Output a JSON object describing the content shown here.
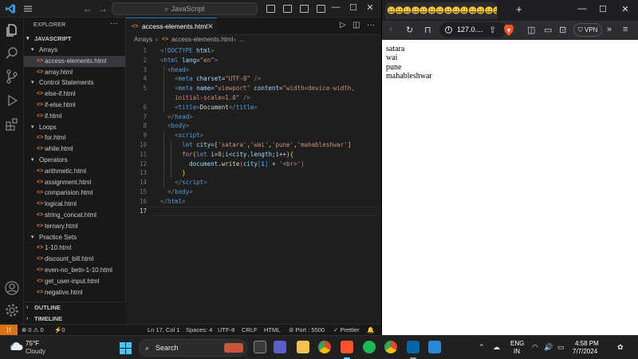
{
  "vscode": {
    "search_placeholder": "JavaScript",
    "explorer_title": "EXPLORER",
    "explorer_more": "···",
    "workspace": "JAVASCRIPT",
    "tree": [
      {
        "type": "folder",
        "label": "Arrays",
        "depth": 1
      },
      {
        "type": "file",
        "label": "access-elements.html",
        "depth": 2,
        "selected": true
      },
      {
        "type": "file",
        "label": "array.html",
        "depth": 2
      },
      {
        "type": "folder",
        "label": "Control Statements",
        "depth": 1
      },
      {
        "type": "file",
        "label": "else-if.html",
        "depth": 2
      },
      {
        "type": "file",
        "label": "if-else.html",
        "depth": 2
      },
      {
        "type": "file",
        "label": "if.html",
        "depth": 2
      },
      {
        "type": "folder",
        "label": "Loops",
        "depth": 1
      },
      {
        "type": "file",
        "label": "for.html",
        "depth": 2
      },
      {
        "type": "file",
        "label": "while.html",
        "depth": 2
      },
      {
        "type": "folder",
        "label": "Operators",
        "depth": 1
      },
      {
        "type": "file",
        "label": "arithmetic.html",
        "depth": 2
      },
      {
        "type": "file",
        "label": "assignment.html",
        "depth": 2
      },
      {
        "type": "file",
        "label": "comparision.html",
        "depth": 2
      },
      {
        "type": "file",
        "label": "logical.html",
        "depth": 2
      },
      {
        "type": "file",
        "label": "string_concat.html",
        "depth": 2
      },
      {
        "type": "file",
        "label": "ternary.html",
        "depth": 2
      },
      {
        "type": "folder",
        "label": "Practice Sets",
        "depth": 1
      },
      {
        "type": "file",
        "label": "1-10.html",
        "depth": 2
      },
      {
        "type": "file",
        "label": "discount_bill.html",
        "depth": 2
      },
      {
        "type": "file",
        "label": "even-no_betn-1-10.html",
        "depth": 2
      },
      {
        "type": "file",
        "label": "get_user-input.html",
        "depth": 2
      },
      {
        "type": "file",
        "label": "negative.html",
        "depth": 2
      }
    ],
    "outline_label": "OUTLINE",
    "timeline_label": "TIMELINE",
    "tab": {
      "title": "access-elements.html",
      "icon": "<>"
    },
    "breadcrumb": {
      "folder": "Arrays",
      "sep1": "›",
      "file_icon": "<>",
      "file": "access-elements.html",
      "sep2": "›",
      "more": "..."
    },
    "line_numbers": [
      "1",
      "2",
      "3",
      "4",
      "5",
      "",
      "6",
      "7",
      "8",
      "9",
      "10",
      "11",
      "12",
      "13",
      "14",
      "15",
      "16",
      "17"
    ],
    "code_lines": [
      [
        {
          "c": "t-br",
          "t": "<!"
        },
        {
          "c": "t-tag",
          "t": "DOCTYPE"
        },
        {
          "c": "t-attr",
          "t": " html"
        },
        {
          "c": "t-br",
          "t": ">"
        }
      ],
      [
        {
          "c": "t-br",
          "t": "<"
        },
        {
          "c": "t-tag",
          "t": "html"
        },
        {
          "c": "t-attr",
          "t": " lang"
        },
        {
          "c": "t-txt",
          "t": "="
        },
        {
          "c": "t-str",
          "t": "\"en\""
        },
        {
          "c": "t-br",
          "t": ">"
        }
      ],
      [
        {
          "c": "t-txt",
          "t": "  "
        },
        {
          "c": "t-br",
          "t": "<"
        },
        {
          "c": "t-tag",
          "t": "head"
        },
        {
          "c": "t-br",
          "t": ">"
        }
      ],
      [
        {
          "c": "t-txt",
          "t": "    "
        },
        {
          "c": "t-br",
          "t": "<"
        },
        {
          "c": "t-tag",
          "t": "meta"
        },
        {
          "c": "t-attr",
          "t": " charset"
        },
        {
          "c": "t-txt",
          "t": "="
        },
        {
          "c": "t-str",
          "t": "\"UTF-8\""
        },
        {
          "c": "t-br",
          "t": " />"
        }
      ],
      [
        {
          "c": "t-txt",
          "t": "    "
        },
        {
          "c": "t-br",
          "t": "<"
        },
        {
          "c": "t-tag",
          "t": "meta"
        },
        {
          "c": "t-attr",
          "t": " name"
        },
        {
          "c": "t-txt",
          "t": "="
        },
        {
          "c": "t-str",
          "t": "\"viewport\""
        },
        {
          "c": "t-attr",
          "t": " content"
        },
        {
          "c": "t-txt",
          "t": "="
        },
        {
          "c": "t-str",
          "t": "\"width=device-width,"
        }
      ],
      [
        {
          "c": "t-str",
          "t": "    initial-scale=1.0\""
        },
        {
          "c": "t-br",
          "t": " />"
        }
      ],
      [
        {
          "c": "t-txt",
          "t": "    "
        },
        {
          "c": "t-br",
          "t": "<"
        },
        {
          "c": "t-tag",
          "t": "title"
        },
        {
          "c": "t-br",
          "t": ">"
        },
        {
          "c": "t-txt",
          "t": "Document"
        },
        {
          "c": "t-br",
          "t": "</"
        },
        {
          "c": "t-tag",
          "t": "title"
        },
        {
          "c": "t-br",
          "t": ">"
        }
      ],
      [
        {
          "c": "t-txt",
          "t": "  "
        },
        {
          "c": "t-br",
          "t": "</"
        },
        {
          "c": "t-tag",
          "t": "head"
        },
        {
          "c": "t-br",
          "t": ">"
        }
      ],
      [
        {
          "c": "t-txt",
          "t": "  "
        },
        {
          "c": "t-br",
          "t": "<"
        },
        {
          "c": "t-tag",
          "t": "body"
        },
        {
          "c": "t-br",
          "t": ">"
        }
      ],
      [
        {
          "c": "t-txt",
          "t": "    "
        },
        {
          "c": "t-br",
          "t": "<"
        },
        {
          "c": "t-tag",
          "t": "script"
        },
        {
          "c": "t-br",
          "t": ">"
        }
      ],
      [
        {
          "c": "t-txt",
          "t": "      "
        },
        {
          "c": "t-kw",
          "t": "let"
        },
        {
          "c": "t-var",
          "t": " city"
        },
        {
          "c": "t-txt",
          "t": "="
        },
        {
          "c": "t-b1",
          "t": "["
        },
        {
          "c": "t-str",
          "t": "'satara'"
        },
        {
          "c": "t-txt",
          "t": ","
        },
        {
          "c": "t-str",
          "t": "'wai'"
        },
        {
          "c": "t-txt",
          "t": ","
        },
        {
          "c": "t-str",
          "t": "'pune'"
        },
        {
          "c": "t-txt",
          "t": ","
        },
        {
          "c": "t-str",
          "t": "'mahableshwar'"
        },
        {
          "c": "t-b1",
          "t": "]"
        }
      ],
      [
        {
          "c": "t-txt",
          "t": "      "
        },
        {
          "c": "t-ctl",
          "t": "for"
        },
        {
          "c": "t-b1",
          "t": "("
        },
        {
          "c": "t-kw",
          "t": "let"
        },
        {
          "c": "t-var",
          "t": " i"
        },
        {
          "c": "t-txt",
          "t": "="
        },
        {
          "c": "t-num",
          "t": "0"
        },
        {
          "c": "t-txt",
          "t": ";"
        },
        {
          "c": "t-var",
          "t": "i"
        },
        {
          "c": "t-txt",
          "t": "<"
        },
        {
          "c": "t-var",
          "t": "city"
        },
        {
          "c": "t-txt",
          "t": "."
        },
        {
          "c": "t-var",
          "t": "length"
        },
        {
          "c": "t-txt",
          "t": ";"
        },
        {
          "c": "t-var",
          "t": "i"
        },
        {
          "c": "t-txt",
          "t": "++"
        },
        {
          "c": "t-b1",
          "t": ")"
        },
        {
          "c": "t-b1",
          "t": "{"
        }
      ],
      [
        {
          "c": "t-txt",
          "t": "        "
        },
        {
          "c": "t-var",
          "t": "document"
        },
        {
          "c": "t-txt",
          "t": "."
        },
        {
          "c": "t-fn",
          "t": "write"
        },
        {
          "c": "t-b2",
          "t": "("
        },
        {
          "c": "t-var",
          "t": "city"
        },
        {
          "c": "t-b3",
          "t": "["
        },
        {
          "c": "t-var",
          "t": "i"
        },
        {
          "c": "t-b3",
          "t": "]"
        },
        {
          "c": "t-txt",
          "t": " + "
        },
        {
          "c": "t-str",
          "t": "'<br>'"
        },
        {
          "c": "t-b2",
          "t": ")"
        }
      ],
      [
        {
          "c": "t-txt",
          "t": "      "
        },
        {
          "c": "t-b1",
          "t": "}"
        }
      ],
      [
        {
          "c": "t-txt",
          "t": "    "
        },
        {
          "c": "t-br",
          "t": "</"
        },
        {
          "c": "t-tag",
          "t": "script"
        },
        {
          "c": "t-br",
          "t": ">"
        }
      ],
      [
        {
          "c": "t-txt",
          "t": "  "
        },
        {
          "c": "t-br",
          "t": "</"
        },
        {
          "c": "t-tag",
          "t": "body"
        },
        {
          "c": "t-br",
          "t": ">"
        }
      ],
      [
        {
          "c": "t-br",
          "t": "</"
        },
        {
          "c": "t-tag",
          "t": "html"
        },
        {
          "c": "t-br",
          "t": ">"
        }
      ],
      []
    ],
    "status": {
      "errors": "0",
      "warnings": "0",
      "ports": "0",
      "position": "Ln 17, Col 1",
      "spaces": "Spaces: 4",
      "encoding": "UTF-8",
      "eol": "CRLF",
      "language": "HTML",
      "port": "Port : 5500",
      "prettier": "Prettier"
    }
  },
  "browser": {
    "tab_title": "😀😀😀😀😀😀😀😀😀😀😀😀😀😀😀😀😀",
    "new_tab": "+",
    "url": "127.0....",
    "vpn": "VPN",
    "content_lines": [
      "satara",
      "wai",
      "pune",
      "mahableshwar"
    ]
  },
  "taskbar": {
    "temperature": "75°F",
    "weather": "Cloudy",
    "search": "Search",
    "lang_line1": "ENG",
    "lang_line2": "IN",
    "time": "4:58 PM",
    "date": "7/7/2024"
  },
  "colors": {
    "accent": "#0078d4",
    "remote": "#d97117",
    "html_file": "#e37933"
  }
}
